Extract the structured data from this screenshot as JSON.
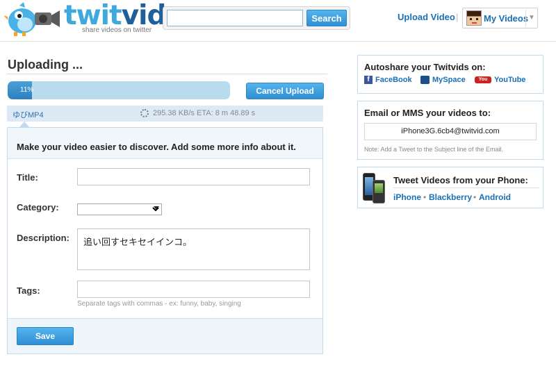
{
  "header": {
    "logo_prefix": "twit",
    "logo_suffix": "vid",
    "tagline": "share videos on twitter",
    "search_placeholder": "",
    "search_button": "Search",
    "upload_link": "Upload Video",
    "separator": "|",
    "my_videos": "My Videos",
    "caret": "▼"
  },
  "upload": {
    "title": "Uploading ...",
    "progress_percent": 11,
    "progress_label": "11%",
    "cancel_button": "Cancel Upload",
    "file_name": "ゆびMP4",
    "speed": "295.38 KB/s",
    "eta": "ETA: 8 m 48.89 s"
  },
  "info_form": {
    "heading": "Make your video easier to discover. Add some more info about it.",
    "title_label": "Title:",
    "title_value": "",
    "category_label": "Category:",
    "category_value": "",
    "description_label": "Description:",
    "description_value": "追い回すセキセイインコ。",
    "tags_label": "Tags:",
    "tags_value": "",
    "tags_hint": "Separate tags with commas - ex: funny, baby, singing",
    "save_button": "Save"
  },
  "autoshare": {
    "title": "Autoshare your Twitvids on:",
    "facebook": "FaceBook",
    "myspace": "MySpace",
    "youtube": "YouTube",
    "facebook_glyph": "f",
    "youtube_glyph": "You"
  },
  "email": {
    "title": "Email or MMS your videos to:",
    "address": "iPhone3G.6cb4@twitvid.com",
    "note": "Note: Add a Tweet to the Subject line of the Email."
  },
  "phone": {
    "title": "Tweet Videos from your Phone:",
    "iphone": "iPhone",
    "blackberry": "Blackberry",
    "android": "Android",
    "dot": "•"
  },
  "colors": {
    "brand_light": "#3fa9dd",
    "brand_dark": "#1f5f9b",
    "link": "#1a6fb5",
    "button": "#2f8fd3"
  }
}
